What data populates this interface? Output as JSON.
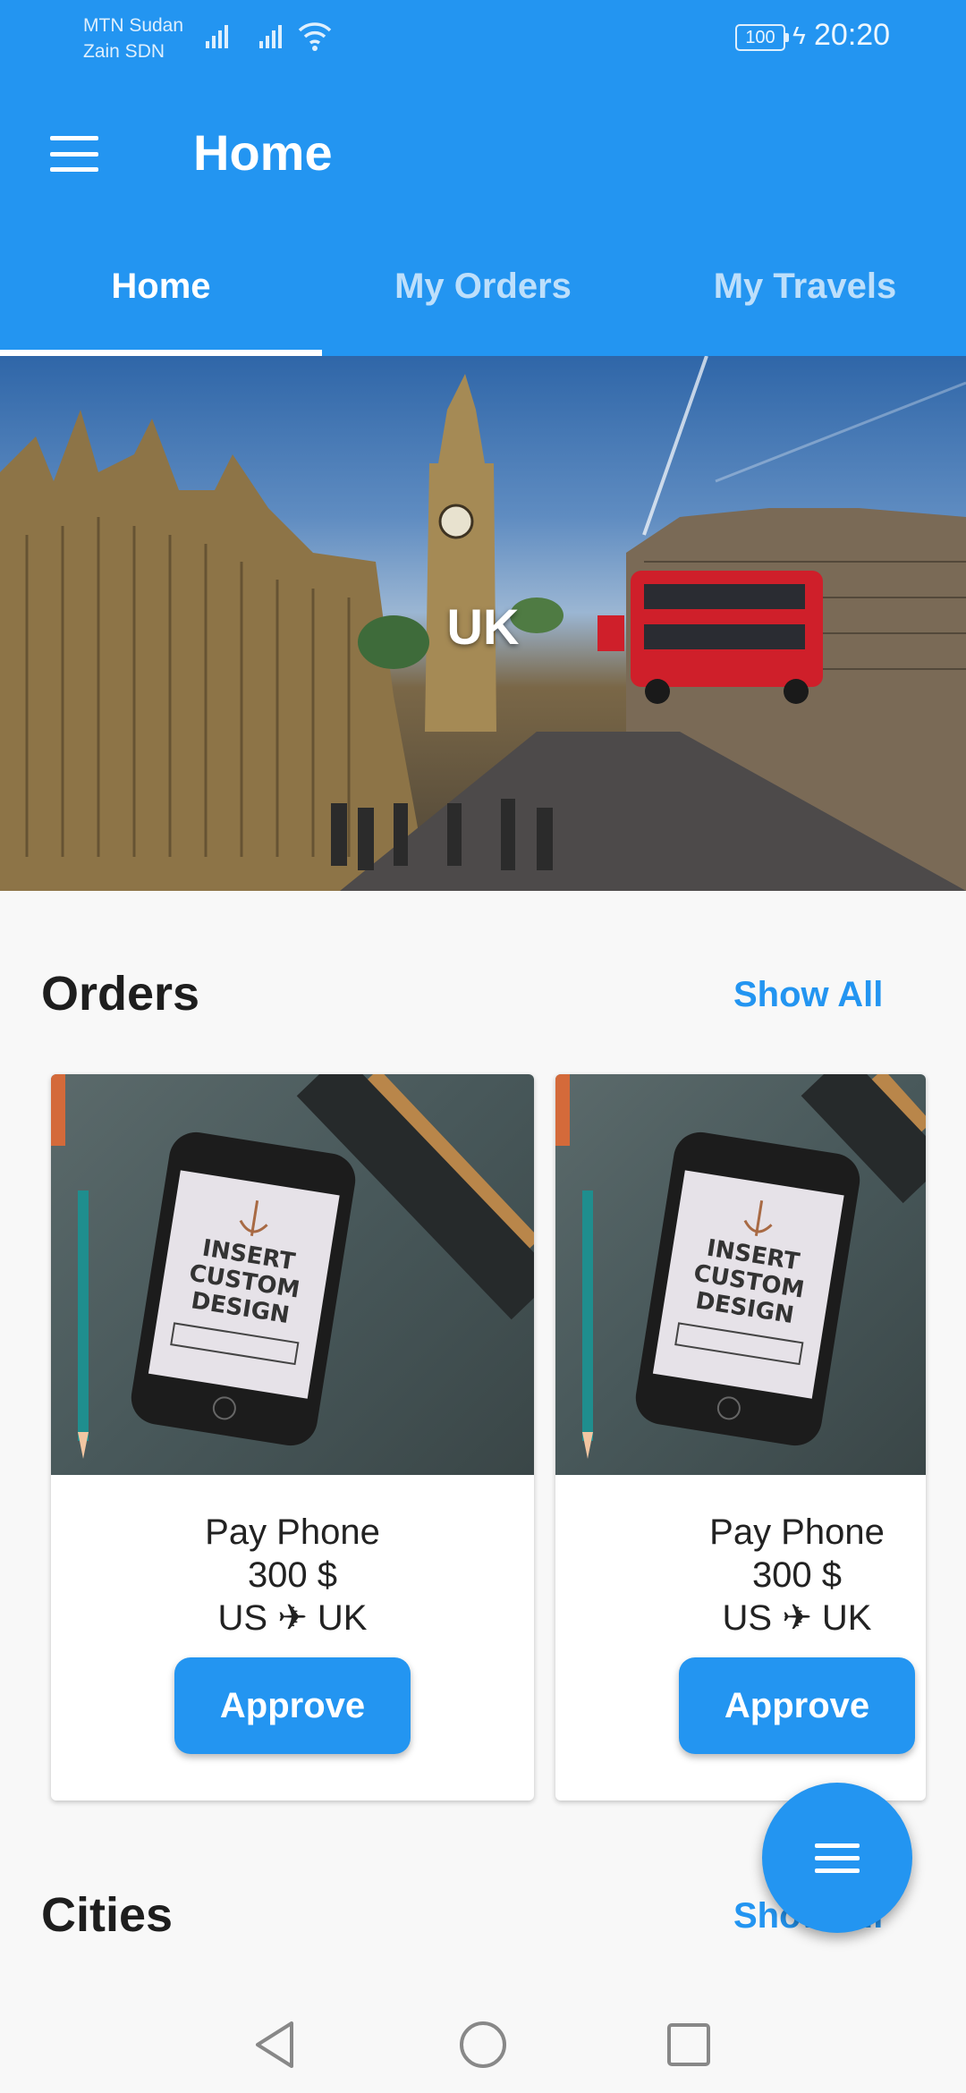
{
  "status_bar": {
    "carrier_1": "MTN Sudan",
    "carrier_2": "Zain SDN",
    "battery": "100",
    "time": "20:20"
  },
  "app_bar": {
    "title": "Home",
    "menu_icon": "hamburger-menu-icon"
  },
  "tabs": [
    {
      "label": "Home",
      "active": true
    },
    {
      "label": "My Orders",
      "active": false
    },
    {
      "label": "My Travels",
      "active": false
    }
  ],
  "hero": {
    "label": "UK"
  },
  "orders": {
    "title": "Orders",
    "show_all": "Show All",
    "items": [
      {
        "name": "Pay Phone",
        "price": "300 $",
        "from": "US",
        "to": "UK",
        "button": "Approve"
      },
      {
        "name": "Pay Phone",
        "price": "300 $",
        "from": "US",
        "to": "UK",
        "button": "Approve"
      }
    ]
  },
  "cities": {
    "title": "Cities",
    "show_all": "Show All"
  },
  "fab": {
    "icon": "menu-icon"
  },
  "colors": {
    "primary": "#2395f1",
    "background": "#f8f8f8"
  }
}
